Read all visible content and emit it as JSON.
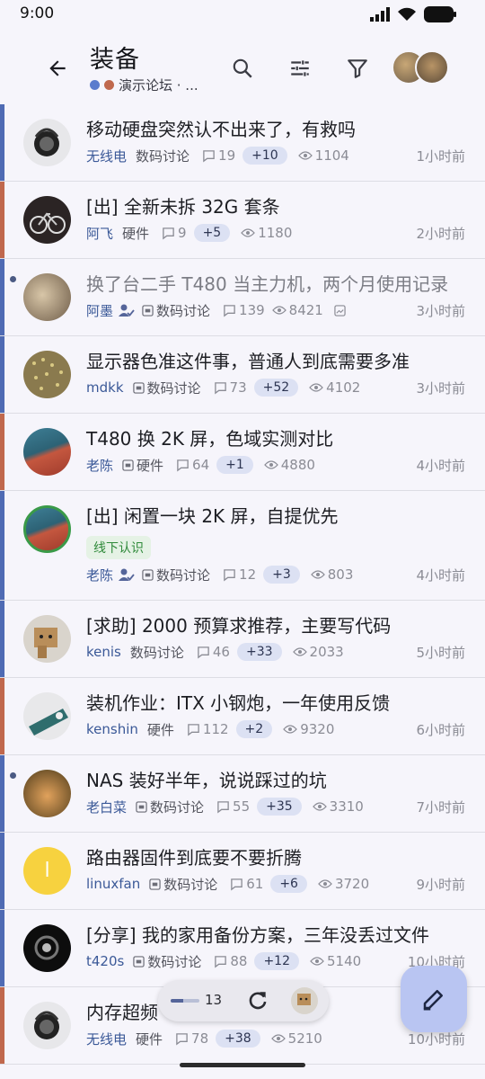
{
  "status": {
    "time": "9:00"
  },
  "header": {
    "title": "装备",
    "subtitle": "演示论坛 · ...",
    "dot_colors": [
      "#5b7ccd",
      "#c0684d"
    ]
  },
  "icons": {
    "back": "arrow-back-icon",
    "search": "search-icon",
    "tune": "tune-icon",
    "filter": "filter-icon",
    "compose": "edit-icon",
    "refresh": "refresh-icon"
  },
  "colors": {
    "accent_blue": "#4f6bb4",
    "accent_orange": "#c0684d",
    "pill": "#dce1f3",
    "fab": "#b9c5f2"
  },
  "topics": [
    {
      "title": "移动硬盘突然认不出来了，有救吗",
      "author": "无线电",
      "category": "数码讨论",
      "replies": "19",
      "new": "+10",
      "views": "1104",
      "time": "1小时前"
    },
    {
      "title": "[出] 全新未拆 32G 套条",
      "author": "阿飞",
      "category": "硬件",
      "replies": "9",
      "new": "+5",
      "views": "1180",
      "time": "2小时前"
    },
    {
      "title": "换了台二手 T480 当主力机，两个月使用记录",
      "author": "阿墨",
      "category": "数码讨论",
      "replies": "139",
      "new": "",
      "views": "8421",
      "time": "3小时前"
    },
    {
      "title": "显示器色准这件事，普通人到底需要多准",
      "author": "mdkk",
      "category": "数码讨论",
      "replies": "73",
      "new": "+52",
      "views": "4102",
      "time": "3小时前"
    },
    {
      "title": "T480 换 2K 屏，色域实测对比",
      "author": "老陈",
      "category": "硬件",
      "replies": "64",
      "new": "+1",
      "views": "4880",
      "time": "4小时前"
    },
    {
      "title": "[出] 闲置一块 2K 屏，自提优先",
      "tag": "线下认识",
      "author": "老陈",
      "category": "数码讨论",
      "replies": "12",
      "new": "+3",
      "views": "803",
      "time": "4小时前"
    },
    {
      "title": "[求助] 2000 预算求推荐，主要写代码",
      "author": "kenis",
      "category": "数码讨论",
      "replies": "46",
      "new": "+33",
      "views": "2033",
      "time": "5小时前"
    },
    {
      "title": "装机作业：ITX 小钢炮，一年使用反馈",
      "author": "kenshin",
      "category": "硬件",
      "replies": "112",
      "new": "+2",
      "views": "9320",
      "time": "6小时前"
    },
    {
      "title": "NAS 装好半年，说说踩过的坑",
      "author": "老白菜",
      "category": "数码讨论",
      "replies": "55",
      "new": "+35",
      "views": "3310",
      "time": "7小时前"
    },
    {
      "title": "路由器固件到底要不要折腾",
      "author": "linuxfan",
      "category": "数码讨论",
      "replies": "61",
      "new": "+6",
      "views": "3720",
      "time": "9小时前",
      "avatar_letter": "l"
    },
    {
      "title": "[分享] 我的家用备份方案，三年没丢过文件",
      "author": "t420s",
      "category": "数码讨论",
      "replies": "88",
      "new": "+12",
      "views": "5140",
      "time": "10小时前"
    },
    {
      "title": "内存超频",
      "author": "无线电",
      "category": "硬件",
      "replies": "78",
      "new": "+38",
      "views": "5210",
      "time": "10小时前"
    }
  ],
  "refresh": {
    "count": "13",
    "progress": 0.45
  }
}
